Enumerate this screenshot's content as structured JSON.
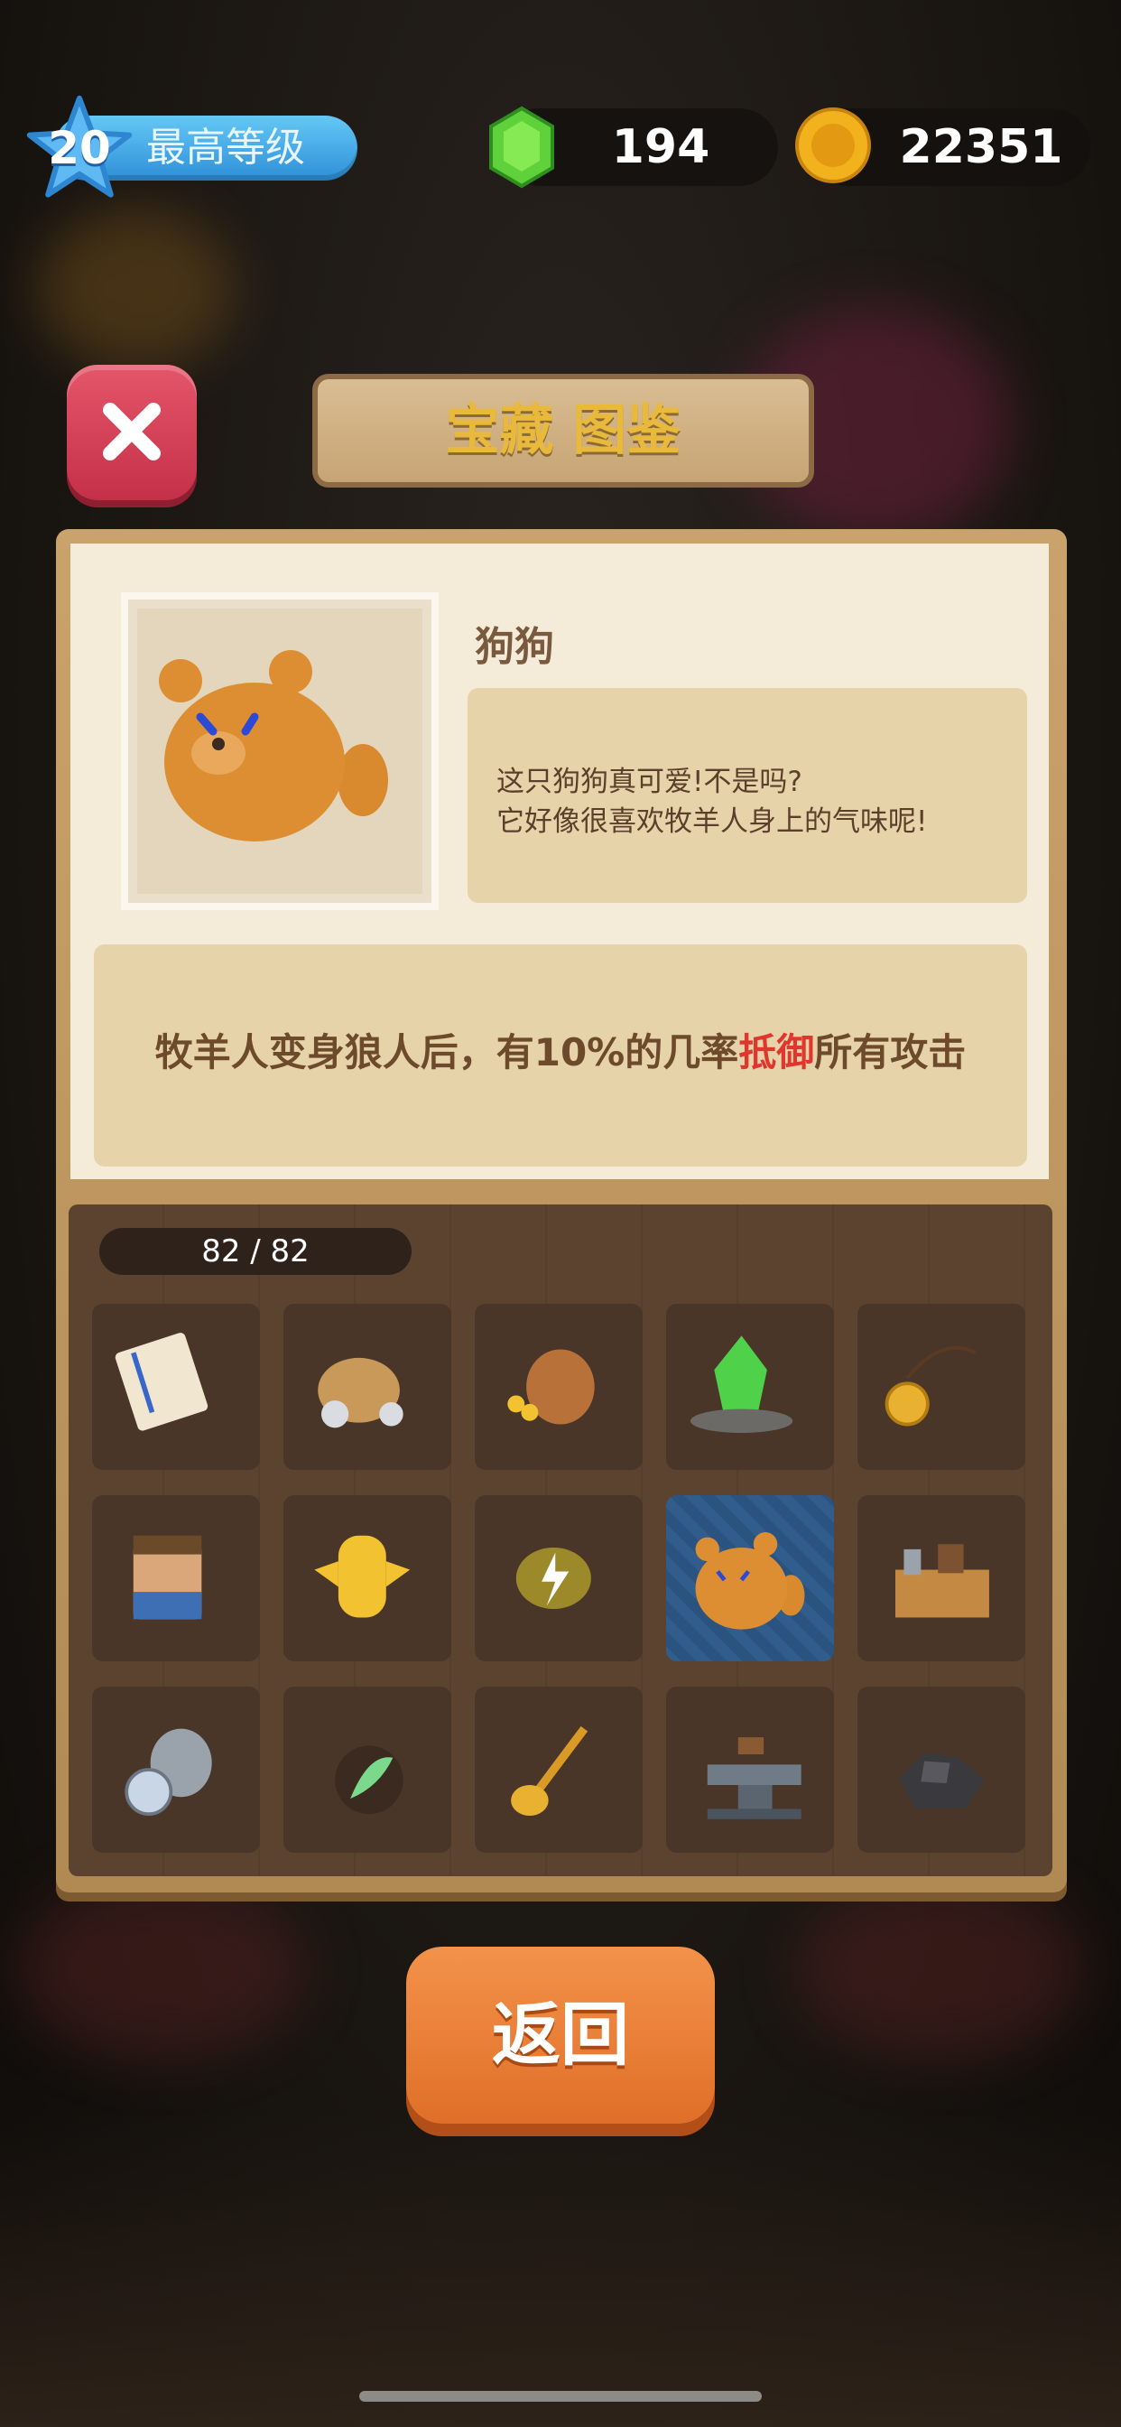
{
  "header": {
    "level_value": "20",
    "level_label": "最高等级",
    "gems": "194",
    "coins": "22351"
  },
  "dialog": {
    "title": "宝藏 图鉴",
    "selected_item": {
      "name": "狗狗",
      "description_lines": [
        "这只狗狗真可爱!不是吗?",
        "它好像很喜欢牧羊人身上的气味呢!"
      ],
      "effect_prefix": "牧羊人变身狼人后，有10%的几率",
      "effect_highlight": "抵御",
      "effect_suffix": "所有攻击"
    },
    "collection_count": "82 / 82",
    "back_label": "返回"
  },
  "colors": {
    "accent_highlight": "#e1362e",
    "close_button": "#d7415a",
    "back_button": "#ea7d34",
    "title_gold": "#e9b93c"
  },
  "items": [
    {
      "icon": "scroll-icon"
    },
    {
      "icon": "money-bag-icon"
    },
    {
      "icon": "pot-gold-icon"
    },
    {
      "icon": "green-crystal-icon"
    },
    {
      "icon": "gold-amulet-icon"
    },
    {
      "icon": "dwarf-miner-icon"
    },
    {
      "icon": "golden-helmet-icon"
    },
    {
      "icon": "lightning-stone-icon"
    },
    {
      "icon": "dog-icon",
      "selected": true
    },
    {
      "icon": "toolbox-icon"
    },
    {
      "icon": "knight-helmet-icon"
    },
    {
      "icon": "feather-icon"
    },
    {
      "icon": "shovel-icon"
    },
    {
      "icon": "anvil-icon"
    },
    {
      "icon": "coal-icon"
    }
  ]
}
